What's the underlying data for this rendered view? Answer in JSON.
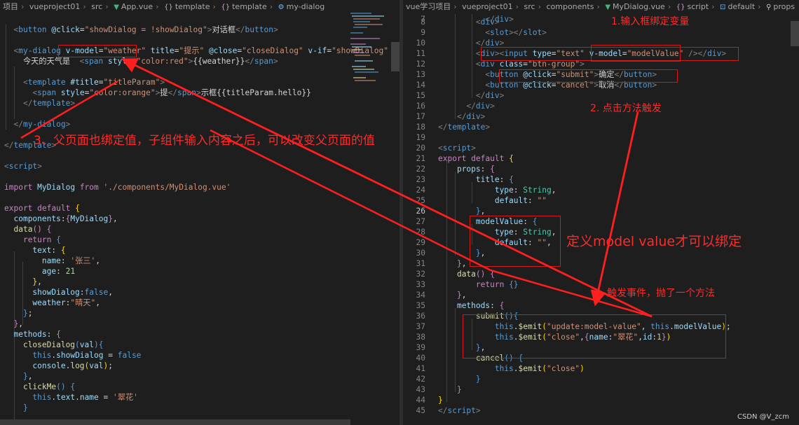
{
  "left_breadcrumb": {
    "crumbs": [
      "项目",
      "vueproject01",
      "src",
      "App.vue",
      "template",
      "template",
      "my-dialog"
    ]
  },
  "right_breadcrumb": {
    "crumbs": [
      "vue学习项目",
      "vueproject01",
      "src",
      "components",
      "MyDialog.vue",
      "script",
      "default",
      "props"
    ]
  },
  "annotations": {
    "note1": "1.输入框绑定变量",
    "note2": "2. 点击方法触发",
    "note3": "3、父页面也绑定值，子组件输入内容之后，可以改变父页面的值",
    "note_model": "定义model value才可以绑定",
    "note_emit": "触发事件，抛了一个方法"
  },
  "watermark": "CSDN @V_zcm"
}
